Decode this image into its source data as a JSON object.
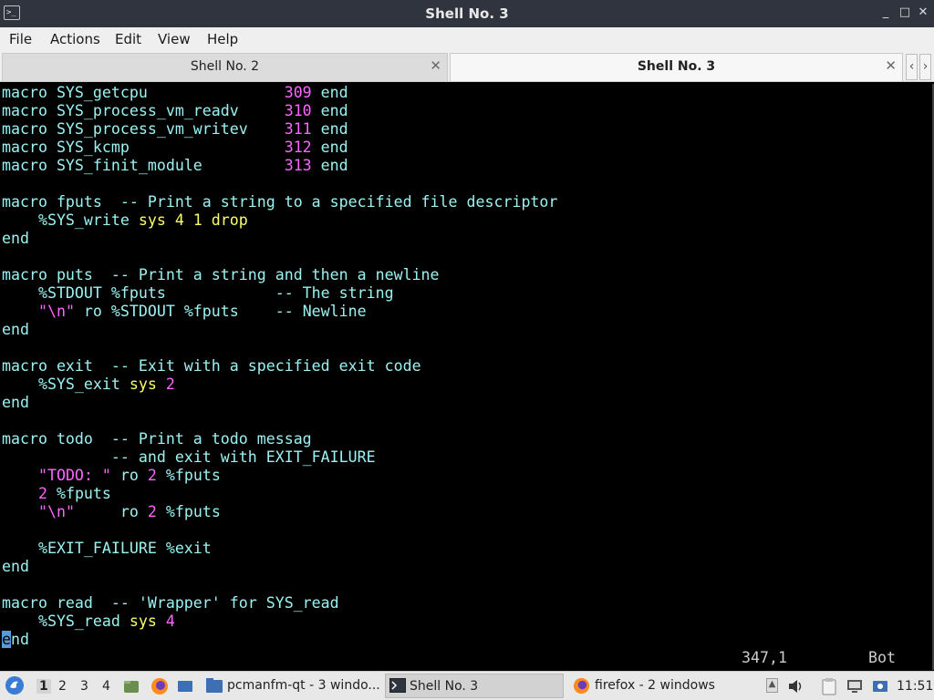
{
  "window": {
    "title": "Shell No. 3",
    "buttons": {
      "minimize": "_",
      "maximize": "□",
      "close": "✕"
    }
  },
  "menu": [
    "File",
    "Actions",
    "Edit",
    "View",
    "Help"
  ],
  "tabs": [
    {
      "label": "Shell No. 2",
      "active": false
    },
    {
      "label": "Shell No. 3",
      "active": true
    }
  ],
  "terminal": {
    "lines": [
      [
        [
          "macro SYS_getcpu               ",
          "kw"
        ],
        [
          "309",
          "num"
        ],
        [
          " end",
          "kw"
        ]
      ],
      [
        [
          "macro SYS_process_vm_readv     ",
          "kw"
        ],
        [
          "310",
          "num"
        ],
        [
          " end",
          "kw"
        ]
      ],
      [
        [
          "macro SYS_process_vm_writev    ",
          "kw"
        ],
        [
          "311",
          "num"
        ],
        [
          " end",
          "kw"
        ]
      ],
      [
        [
          "macro SYS_kcmp                 ",
          "kw"
        ],
        [
          "312",
          "num"
        ],
        [
          " end",
          "kw"
        ]
      ],
      [
        [
          "macro SYS_finit_module         ",
          "kw"
        ],
        [
          "313",
          "num"
        ],
        [
          " end",
          "kw"
        ]
      ],
      [],
      [
        [
          "macro fputs  -- Print a string to a specified file descriptor",
          "kw"
        ]
      ],
      [
        [
          "    %SYS_write ",
          "kw"
        ],
        [
          "sys 4 1 drop",
          "yel"
        ]
      ],
      [
        [
          "end",
          "kw"
        ]
      ],
      [],
      [
        [
          "macro puts  -- Print a string and then a newline",
          "kw"
        ]
      ],
      [
        [
          "    %STDOUT %fputs            -- The string",
          "kw"
        ]
      ],
      [
        [
          "    ",
          "kw"
        ],
        [
          "\"\\n\"",
          "str"
        ],
        [
          " ro %STDOUT %fputs    -- Newline",
          "kw"
        ]
      ],
      [
        [
          "end",
          "kw"
        ]
      ],
      [],
      [
        [
          "macro exit  -- Exit with a specified exit code",
          "kw"
        ]
      ],
      [
        [
          "    %SYS_exit ",
          "kw"
        ],
        [
          "sys ",
          "yel"
        ],
        [
          "2",
          "num"
        ]
      ],
      [
        [
          "end",
          "kw"
        ]
      ],
      [],
      [
        [
          "macro todo  -- Print a todo messag",
          "kw"
        ]
      ],
      [
        [
          "            -- and exit with EXIT_FAILURE",
          "kw"
        ]
      ],
      [
        [
          "    ",
          "kw"
        ],
        [
          "\"TODO: \"",
          "str"
        ],
        [
          " ro ",
          "kw"
        ],
        [
          "2",
          "num"
        ],
        [
          " %fputs",
          "kw"
        ]
      ],
      [
        [
          "    ",
          "kw"
        ],
        [
          "2",
          "num"
        ],
        [
          " %fputs",
          "kw"
        ]
      ],
      [
        [
          "    ",
          "kw"
        ],
        [
          "\"\\n\"",
          "str"
        ],
        [
          "     ro ",
          "kw"
        ],
        [
          "2",
          "num"
        ],
        [
          " %fputs",
          "kw"
        ]
      ],
      [],
      [
        [
          "    %EXIT_FAILURE %exit",
          "kw"
        ]
      ],
      [
        [
          "end",
          "kw"
        ]
      ],
      [],
      [
        [
          "macro read  -- 'Wrapper' for SYS_read",
          "kw"
        ]
      ],
      [
        [
          "    %SYS_read ",
          "kw"
        ],
        [
          "sys ",
          "yel"
        ],
        [
          "4",
          "num"
        ]
      ],
      [
        [
          "e",
          "cursor"
        ],
        [
          "nd",
          "kw"
        ]
      ]
    ],
    "status_position": "347,1",
    "status_scroll": "Bot"
  },
  "taskbar": {
    "desktops": [
      "1",
      "2",
      "3",
      "4"
    ],
    "active_desktop": "1",
    "tasks": [
      {
        "label": "pcmanfm-qt - 3 windo...",
        "icon": "folder-icon"
      },
      {
        "label": "Shell No. 3",
        "icon": "terminal-icon"
      },
      {
        "label": "firefox - 2 windows",
        "icon": "firefox-icon"
      }
    ],
    "clock": "11:51",
    "colors": {
      "accent": "#2f343f",
      "terminal_text": "#9bf2f2",
      "number": "#ff66ff",
      "keyword_sys": "#ffff66"
    }
  }
}
